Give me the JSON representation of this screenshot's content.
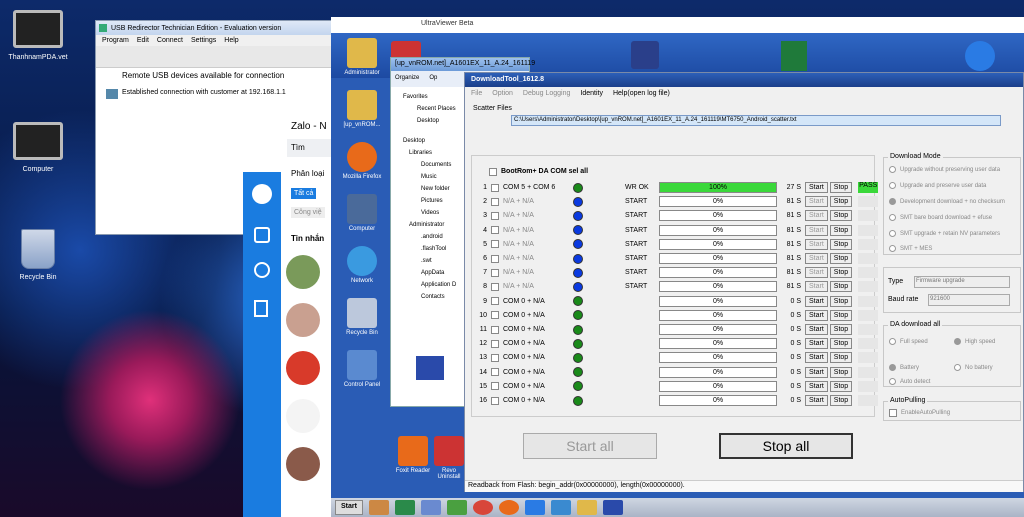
{
  "desktop": {
    "icons": [
      {
        "label": "ThanhnamPDA.vet"
      },
      {
        "label": "Computer"
      },
      {
        "label": "Recycle Bin"
      }
    ]
  },
  "usb": {
    "title": "USB Redirector Technician Edition - Evaluation version",
    "menu": [
      "Program",
      "Edit",
      "Connect",
      "Settings",
      "Help"
    ],
    "header": "Remote USB devices available for connection",
    "status": "Established connection with customer at 192.168.1.1"
  },
  "zalo": {
    "title": "Zalo - N",
    "search": "Tìm",
    "category": "Phân loại",
    "all_tab": "Tất cả",
    "work": "Công việ",
    "inbox": "Tin nhắn"
  },
  "uv": {
    "title": "UltraViewer Beta",
    "left_icons": [
      "Administrator",
      "[up_vnROM...",
      "Mozilla Firefox",
      "Computer",
      "Network",
      "Recycle Bin",
      "Control Panel"
    ],
    "bottom_icons": [
      "Foxit Reader",
      "Revo Uninstall"
    ]
  },
  "explorer": {
    "title": "[up_vnROM.net]_A1601EX_11_A.24_161119",
    "organize": "Organize",
    "open": "Op",
    "tree": [
      "Favorites",
      "Recent Places",
      "Desktop",
      "Desktop",
      "Libraries",
      "Documents",
      "Music",
      "New folder",
      "Pictures",
      "Videos",
      "Administrator",
      ".android",
      ".flashTool",
      ".swt",
      "AppData",
      "Application D",
      "Contacts"
    ]
  },
  "dt": {
    "title": "DownloadTool_1612.8",
    "menu": [
      "File",
      "Option",
      "Debug Logging",
      "Identity",
      "Help(open log file)"
    ],
    "scatter_label": "Scatter Files",
    "scatter_path": "C:\\Users\\Administrator\\Desktop\\[up_vnROM.net]_A1601EX_11_A.24_161119\\MT6750_Android_scatter.txt",
    "header": "BootRom+ DA COM sel all",
    "rows": [
      {
        "n": "1",
        "com": "COM 5 + COM 6",
        "dot": "#1a8a1a",
        "status": "WR OK",
        "pct": "100%",
        "fill": 1,
        "time": "27 S",
        "result": "PASS"
      },
      {
        "n": "2",
        "com": "N/A + N/A",
        "dot": "#0a3ae0",
        "status": "START",
        "pct": "0%",
        "fill": 0,
        "time": "81 S",
        "result": ""
      },
      {
        "n": "3",
        "com": "N/A + N/A",
        "dot": "#0a3ae0",
        "status": "START",
        "pct": "0%",
        "fill": 0,
        "time": "81 S",
        "result": ""
      },
      {
        "n": "4",
        "com": "N/A + N/A",
        "dot": "#0a3ae0",
        "status": "START",
        "pct": "0%",
        "fill": 0,
        "time": "81 S",
        "result": ""
      },
      {
        "n": "5",
        "com": "N/A + N/A",
        "dot": "#0a3ae0",
        "status": "START",
        "pct": "0%",
        "fill": 0,
        "time": "81 S",
        "result": ""
      },
      {
        "n": "6",
        "com": "N/A + N/A",
        "dot": "#0a3ae0",
        "status": "START",
        "pct": "0%",
        "fill": 0,
        "time": "81 S",
        "result": ""
      },
      {
        "n": "7",
        "com": "N/A + N/A",
        "dot": "#0a3ae0",
        "status": "START",
        "pct": "0%",
        "fill": 0,
        "time": "81 S",
        "result": ""
      },
      {
        "n": "8",
        "com": "N/A + N/A",
        "dot": "#0a3ae0",
        "status": "START",
        "pct": "0%",
        "fill": 0,
        "time": "81 S",
        "result": ""
      },
      {
        "n": "9",
        "com": "COM 0 + N/A",
        "dot": "#1a8a1a",
        "status": "",
        "pct": "0%",
        "fill": 0,
        "time": "0 S",
        "result": ""
      },
      {
        "n": "10",
        "com": "COM 0 + N/A",
        "dot": "#1a8a1a",
        "status": "",
        "pct": "0%",
        "fill": 0,
        "time": "0 S",
        "result": ""
      },
      {
        "n": "11",
        "com": "COM 0 + N/A",
        "dot": "#1a8a1a",
        "status": "",
        "pct": "0%",
        "fill": 0,
        "time": "0 S",
        "result": ""
      },
      {
        "n": "12",
        "com": "COM 0 + N/A",
        "dot": "#1a8a1a",
        "status": "",
        "pct": "0%",
        "fill": 0,
        "time": "0 S",
        "result": ""
      },
      {
        "n": "13",
        "com": "COM 0 + N/A",
        "dot": "#1a8a1a",
        "status": "",
        "pct": "0%",
        "fill": 0,
        "time": "0 S",
        "result": ""
      },
      {
        "n": "14",
        "com": "COM 0 + N/A",
        "dot": "#1a8a1a",
        "status": "",
        "pct": "0%",
        "fill": 0,
        "time": "0 S",
        "result": ""
      },
      {
        "n": "15",
        "com": "COM 0 + N/A",
        "dot": "#1a8a1a",
        "status": "",
        "pct": "0%",
        "fill": 0,
        "time": "0 S",
        "result": ""
      },
      {
        "n": "16",
        "com": "COM 0 + N/A",
        "dot": "#1a8a1a",
        "status": "",
        "pct": "0%",
        "fill": 0,
        "time": "0 S",
        "result": ""
      }
    ],
    "start_btn": "Start",
    "stop_btn": "Stop",
    "start_all": "Start all",
    "stop_all": "Stop all",
    "download_mode": {
      "label": "Download Mode",
      "options": [
        "Upgrade without preserving user data",
        "Upgrade and preserve user data",
        "Development download + no checksum",
        "SMT bare board download + efuse",
        "SMT upgrade + retain NV parameters",
        "SMT + MES"
      ]
    },
    "type_label": "Type",
    "type_value": "Firmware upgrade",
    "baud_label": "Baud rate",
    "baud_value": "921600",
    "da": {
      "label": "DA download all",
      "options": [
        "Full speed",
        "High speed",
        "Battery",
        "No battery",
        "Auto detect"
      ]
    },
    "autopull": {
      "label": "AutoPulling",
      "option": "EnableAutoPulling"
    },
    "footer": "Readback from Flash:  begin_addr(0x00000000), length(0x00000000)."
  },
  "taskbar": {
    "start": "Start"
  }
}
